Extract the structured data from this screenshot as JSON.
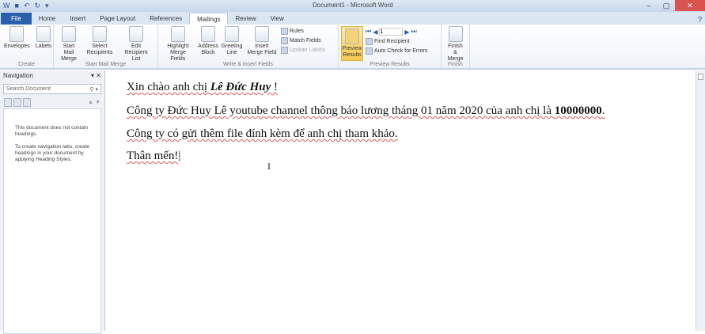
{
  "window": {
    "title": "Document1 - Microsoft Word"
  },
  "tabs": [
    {
      "label": "File"
    },
    {
      "label": "Home"
    },
    {
      "label": "Insert"
    },
    {
      "label": "Page Layout"
    },
    {
      "label": "References"
    },
    {
      "label": "Mailings",
      "active": true
    },
    {
      "label": "Review"
    },
    {
      "label": "View"
    }
  ],
  "ribbon": {
    "create": {
      "label": "Create",
      "envelopes": "Envelopes",
      "labels": "Labels"
    },
    "start": {
      "label": "Start Mail Merge",
      "start_mail_merge": "Start Mail Merge",
      "select_recipients": "Select Recipients",
      "edit_list": "Edit Recipient List"
    },
    "write": {
      "label": "Write & Insert Fields",
      "highlight": "Highlight Merge Fields",
      "address": "Address Block",
      "greeting": "Greeting Line",
      "insert_field": "Insert Merge Field",
      "rules": "Rules",
      "match": "Match Fields",
      "update": "Update Labels"
    },
    "preview": {
      "label": "Preview Results",
      "preview_results": "Preview Results",
      "record": "1",
      "find": "Find Recipient",
      "auto_check": "Auto Check for Errors"
    },
    "finish": {
      "label": "Finish",
      "finish_merge": "Finish & Merge"
    }
  },
  "nav": {
    "title": "Navigation",
    "search_placeholder": "Search Document",
    "msg1": "This document does not contain headings.",
    "msg2": "To create navigation tabs, create headings in your document by applying Heading Styles."
  },
  "doc": {
    "l1a": "Xin chào anh chị ",
    "l1b": "Lê Đức Huy",
    "l1c": " !",
    "l2a": "Công ty Đức Huy Lê youtube channel thông báo lương tháng 01 năm 2020 của anh chị là ",
    "l2b": "10000000",
    ".l2c": "",
    "l2c": ".",
    "l3": "Công ty có gửi thêm file đính kèm để anh chị tham khảo.",
    "l4": "Thân mến!"
  }
}
